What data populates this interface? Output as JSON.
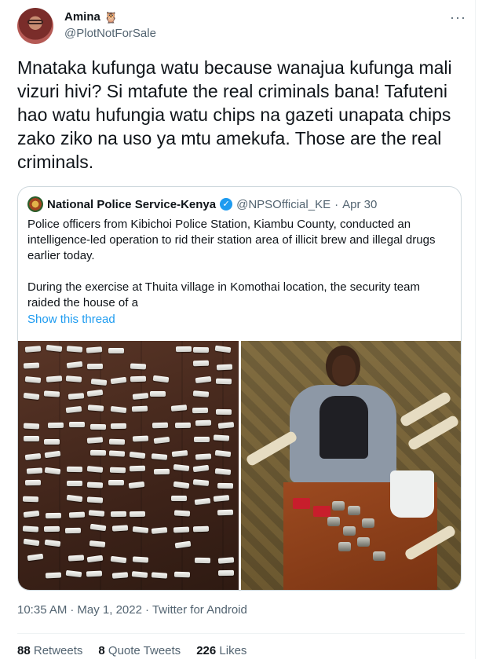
{
  "author": {
    "name": "Amina",
    "emoji": "🦉",
    "handle": "@PlotNotForSale"
  },
  "tweet": {
    "text": "Mnataka kufunga watu because wanajua kufunga mali vizuri hivi? Si mtafute the real criminals bana! Tafuteni hao watu hufungia watu chips na gazeti unapata chips zako ziko na uso ya mtu amekufa. Those are the real criminals."
  },
  "quote": {
    "name": "National Police Service-Kenya",
    "handle": "@NPSOfficial_KE",
    "date": "Apr 30",
    "text": "Police officers from Kibichoi Police Station, Kiambu County, conducted an intelligence-led operation to rid their station area of illicit brew and illegal drugs earlier today.\n\nDuring the exercise at Thuita village in Komothai location, the security team raided the house of a",
    "show_thread": "Show this thread"
  },
  "meta": {
    "time": "10:35 AM",
    "date": "May 1, 2022",
    "source": "Twitter for Android"
  },
  "stats": {
    "retweets_count": "88",
    "retweets_label": "Retweets",
    "quotes_count": "8",
    "quotes_label": "Quote Tweets",
    "likes_count": "226",
    "likes_label": "Likes"
  },
  "icons": {
    "more": "more-options-icon",
    "verified": "verified-badge-icon"
  },
  "colors": {
    "link": "#1d9bf0",
    "secondary_text": "#536471",
    "border": "#cfd9de"
  }
}
